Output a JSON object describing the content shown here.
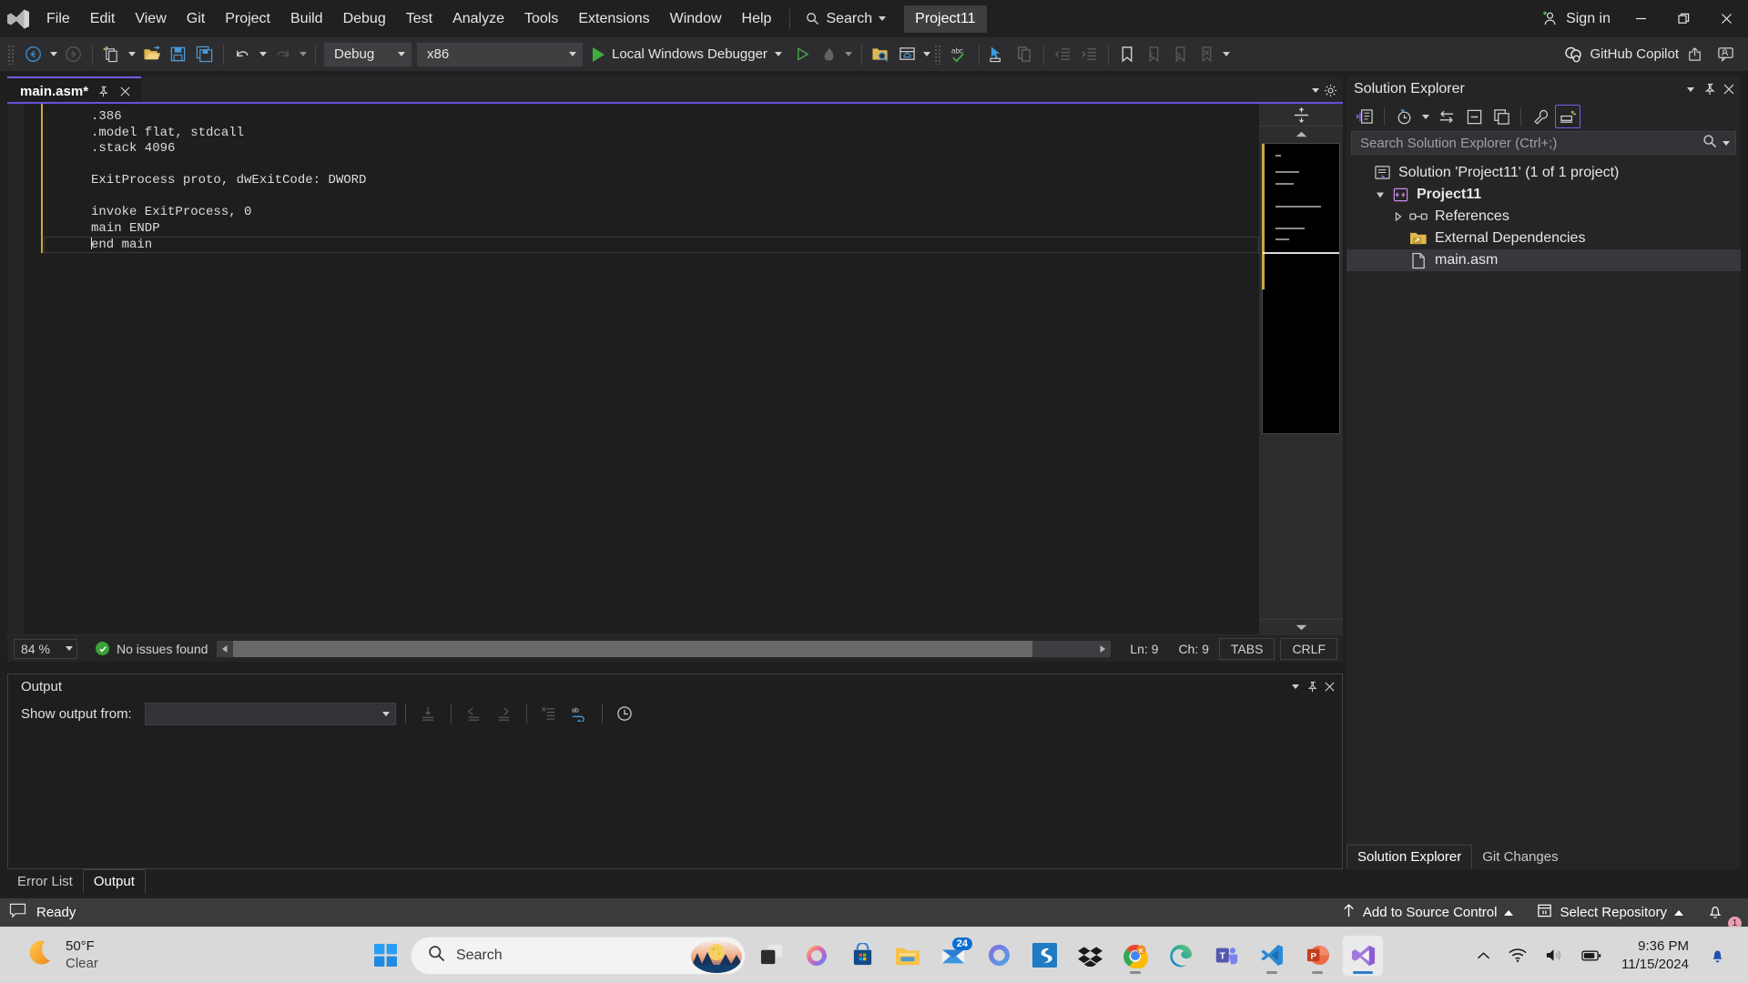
{
  "titlebar": {
    "logo_icon": "visual-studio-logo-icon",
    "menus": [
      "File",
      "Edit",
      "View",
      "Git",
      "Project",
      "Build",
      "Debug",
      "Test",
      "Analyze",
      "Tools",
      "Extensions",
      "Window",
      "Help"
    ],
    "search_label": "Search",
    "search_icon": "magnifier-icon",
    "project_chip": "Project11",
    "signin_label": "Sign in",
    "signin_icon": "person-add-icon",
    "minimize_icon": "minimize-icon",
    "restore_icon": "restore-icon",
    "close_icon": "close-icon"
  },
  "toolbar": {
    "navigate_back_icon": "arrow-back-circle-icon",
    "navigate_forward_icon": "arrow-forward-circle-icon",
    "new_item_icon": "new-item-icon",
    "open_file_icon": "open-folder-icon",
    "save_icon": "save-icon",
    "save_all_icon": "save-all-icon",
    "undo_icon": "undo-icon",
    "redo_icon": "redo-icon",
    "config_value": "Debug",
    "platform_value": "x86",
    "debug_label": "Local Windows Debugger",
    "debug_play_icon": "play-green-icon",
    "attach_icon": "play-outline-icon",
    "hot_reload_icon": "flame-icon",
    "solution_explorer_icon": "folder-search-icon",
    "live_share_icon": "window-home-icon",
    "spell_icon": "abc-check-icon",
    "pointer_icon": "pointer-select-icon",
    "copy_icon": "copy-lines-icon",
    "outdent_icon": "outdent-icon",
    "indent_icon": "indent-icon",
    "bookmark_icon": "bookmark-icon",
    "bookmark_prev_icon": "bookmark-prev-icon",
    "bookmark_next_icon": "bookmark-next-icon",
    "bookmark_clear_icon": "bookmark-clear-icon",
    "overflow_icon": "chevron-overflow-icon",
    "copilot_label": "GitHub Copilot",
    "copilot_icon": "github-copilot-icon",
    "share_icon": "share-icon",
    "feedback_icon": "feedback-person-icon"
  },
  "editor": {
    "tab_title": "main.asm*",
    "tab_pin_icon": "pin-icon",
    "tab_close_icon": "close-icon",
    "tabstrip_menu_icon": "chevron-down-icon",
    "tabstrip_settings_icon": "gear-icon",
    "accent_color": "#6c4fd8",
    "change_bar_color": "#c9a64a",
    "code_lines": [
      "    .386",
      "    .model flat, stdcall",
      "    .stack 4096",
      "",
      "    ExitProcess proto, dwExitCode: DWORD",
      "",
      "    invoke ExitProcess, 0",
      "    main ENDP",
      "    end main"
    ],
    "current_line_index": 8,
    "status": {
      "zoom": "84 %",
      "issues_text": "No issues found",
      "issues_icon": "check-circle-green-icon",
      "line_label": "Ln: 9",
      "char_label": "Ch: 9",
      "tabs_label": "TABS",
      "eol_label": "CRLF"
    },
    "minimap": {
      "split_icon": "split-view-icon",
      "scroll_up_icon": "chevron-up-icon",
      "scroll_down_icon": "chevron-down-icon"
    }
  },
  "output": {
    "title": "Output",
    "menu_icon": "chevron-down-icon",
    "pin_icon": "pin-icon",
    "close_icon": "close-icon",
    "show_output_label": "Show output from:",
    "source_value": "",
    "source_dropdown_icon": "chevron-down-icon",
    "find_message_icon": "find-message-icon",
    "go_prev_icon": "arrow-left-message-icon",
    "go_next_icon": "arrow-right-message-icon",
    "clear_all_icon": "clear-all-icon",
    "word_wrap_icon": "word-wrap-icon",
    "timestamp_icon": "clock-icon",
    "tabs": [
      {
        "label": "Error List",
        "active": false
      },
      {
        "label": "Output",
        "active": true
      }
    ]
  },
  "solution_explorer": {
    "title": "Solution Explorer",
    "menu_icon": "chevron-down-icon",
    "pin_icon": "pin-icon",
    "close_icon": "close-icon",
    "toolbar": {
      "code_view_icon": "solution-code-icon",
      "pending_changes_icon": "pending-changes-clock-icon",
      "pending_dropdown_icon": "chevron-down-icon",
      "sync_icon": "sync-active-document-icon",
      "collapse_all_icon": "collapse-all-icon",
      "show_all_files_icon": "show-all-files-icon",
      "properties_icon": "wrench-properties-icon",
      "preview_icon": "preview-selected-icon"
    },
    "search_placeholder": "Search Solution Explorer (Ctrl+;)",
    "search_icon": "magnifier-icon",
    "search_dropdown_icon": "chevron-down-icon",
    "tree": [
      {
        "label": "Solution 'Project11' (1 of 1 project)",
        "icon": "solution-icon",
        "indent": 0,
        "twisty": "none",
        "bold": false,
        "selected": false
      },
      {
        "label": "Project11",
        "icon": "project-cpp-icon",
        "indent": 1,
        "twisty": "open",
        "bold": true,
        "selected": false
      },
      {
        "label": "References",
        "icon": "references-icon",
        "indent": 2,
        "twisty": "closed",
        "bold": false,
        "selected": false
      },
      {
        "label": "External Dependencies",
        "icon": "external-dependencies-icon",
        "indent": 2,
        "twisty": "none",
        "bold": false,
        "selected": false
      },
      {
        "label": "main.asm",
        "icon": "file-icon",
        "indent": 2,
        "twisty": "none",
        "bold": false,
        "selected": true
      }
    ],
    "bottom_tabs": [
      {
        "label": "Solution Explorer",
        "active": true
      },
      {
        "label": "Git Changes",
        "active": false
      }
    ]
  },
  "vs_status_bar": {
    "status_icon": "speech-balloon-icon",
    "status_text": "Ready",
    "add_to_source_control": "Add to Source Control",
    "add_to_source_control_icon": "arrow-up-icon",
    "select_repository": "Select Repository",
    "select_repository_icon": "repository-icon",
    "notifications_icon": "bell-icon",
    "notifications_count": "1"
  },
  "taskbar": {
    "weather": {
      "temperature": "50°F",
      "condition": "Clear",
      "icon": "moon-icon"
    },
    "start_icon": "windows-start-icon",
    "search_placeholder": "Search",
    "search_icon": "magnifier-icon",
    "search_image_icon": "moon-landscape-icon",
    "apps": [
      {
        "name": "task-view",
        "icon": "task-view-icon",
        "running": false,
        "active": false
      },
      {
        "name": "copilot",
        "icon": "copilot-icon",
        "running": false,
        "active": false
      },
      {
        "name": "microsoft-store",
        "icon": "microsoft-store-icon",
        "running": false,
        "active": false
      },
      {
        "name": "file-explorer",
        "icon": "file-explorer-icon",
        "running": false,
        "active": false
      },
      {
        "name": "mail",
        "icon": "mail-icon",
        "running": false,
        "active": false,
        "badge": "24"
      },
      {
        "name": "microsoft-365",
        "icon": "microsoft-365-icon",
        "running": false,
        "active": false
      },
      {
        "name": "snagit",
        "icon": "snagit-icon",
        "running": false,
        "active": false
      },
      {
        "name": "dropbox",
        "icon": "dropbox-icon",
        "running": false,
        "active": false
      },
      {
        "name": "google-chrome",
        "icon": "chrome-kindle-icon",
        "running": true,
        "active": false
      },
      {
        "name": "microsoft-edge",
        "icon": "edge-icon",
        "running": false,
        "active": false
      },
      {
        "name": "microsoft-teams",
        "icon": "teams-icon",
        "running": false,
        "active": false
      },
      {
        "name": "visual-studio-code",
        "icon": "vscode-icon",
        "running": true,
        "active": false
      },
      {
        "name": "powerpoint",
        "icon": "powerpoint-icon",
        "running": true,
        "active": false
      },
      {
        "name": "visual-studio",
        "icon": "visual-studio-icon",
        "running": true,
        "active": true
      }
    ],
    "tray": {
      "overflow_icon": "chevron-up-icon",
      "wifi_icon": "wifi-icon",
      "volume_icon": "speaker-icon",
      "battery_icon": "battery-icon",
      "time": "9:36 PM",
      "date": "11/15/2024",
      "notification_icon": "bell-blue-icon"
    }
  }
}
